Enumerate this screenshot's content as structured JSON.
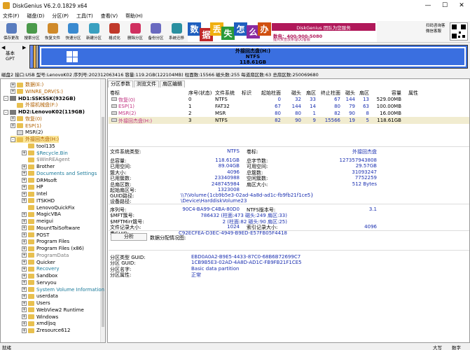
{
  "title": "DiskGenius V6.2.0.1829 x64",
  "menu": [
    "文件(F)",
    "磁盘(D)",
    "分区(P)",
    "工具(T)",
    "查看(V)",
    "帮助(H)"
  ],
  "toolbar": [
    {
      "label": "保存更改",
      "color": "#5a7dbf"
    },
    {
      "label": "搜索分区",
      "color": "#4b9a4b"
    },
    {
      "label": "恢复文件",
      "color": "#d08a2a"
    },
    {
      "label": "快速分区",
      "color": "#3a8ad0"
    },
    {
      "label": "新建分区",
      "color": "#3aa0c0"
    },
    {
      "label": "格式化",
      "color": "#c0392b"
    },
    {
      "label": "删除分区",
      "color": "#d03060"
    },
    {
      "label": "备份分区",
      "color": "#6a6ac0"
    },
    {
      "label": "系统迁移",
      "color": "#2a90a0"
    }
  ],
  "banner": {
    "tiles": [
      {
        "char": "数",
        "color": "#1f5fbf"
      },
      {
        "char": "据",
        "color": "#c0282a"
      },
      {
        "char": "丢",
        "color": "#f0b010"
      },
      {
        "char": "失",
        "color": "#2a9a3a"
      },
      {
        "char": "怎",
        "color": "#1f5fbf"
      },
      {
        "char": "么",
        "color": "#8a2aa0"
      },
      {
        "char": "办",
        "color": "#d05010"
      }
    ],
    "slogan": "DiskGenius 团队为您服务",
    "phone": "数电：400-900-5080",
    "sub": "提点资查放条理QQ客服"
  },
  "qr_label": [
    "扫码咨询客",
    "微信客服"
  ],
  "disk_map": {
    "basic": "基本",
    "gpt": "GPT",
    "label": "外接回杰盘(H:)",
    "fs": "NTFS",
    "size": "118.61GB"
  },
  "disk_info": "磁盘2 接口:USB  型号:LenovoK02  序列号:202312063416  容量:119.2GB(122104MB)  柱面数:15566  磁头数:255  每道扇区数:63  总扇区数:250069680",
  "tree": [
    {
      "indent": 14,
      "exp": "+",
      "icon": "fld",
      "text": "数据(E:)",
      "color": "#b06000"
    },
    {
      "indent": 14,
      "exp": "+",
      "icon": "fld",
      "text": "WINRE_DRV(S:)",
      "color": "#b06000"
    },
    {
      "indent": 4,
      "exp": "-",
      "icon": "dsk",
      "text": "HD1:SSKSSK(932GB)",
      "color": "#000",
      "bold": true
    },
    {
      "indent": 14,
      "exp": "",
      "icon": "fld",
      "text": "外接机械盘(F:)",
      "color": "#b06000"
    },
    {
      "indent": 4,
      "exp": "-",
      "icon": "dsk",
      "text": "HD2:LenovoK02(119GB)",
      "color": "#000",
      "bold": true
    },
    {
      "indent": 14,
      "exp": "+",
      "icon": "fld",
      "text": "恢复(0)",
      "color": "#b06000"
    },
    {
      "indent": 14,
      "exp": "+",
      "icon": "fld",
      "text": "ESP(1)",
      "color": "#b06000"
    },
    {
      "indent": 14,
      "exp": "",
      "icon": "prt",
      "text": "MSR(2)",
      "color": "#000"
    },
    {
      "indent": 14,
      "exp": "-",
      "icon": "fld",
      "text": "外接回杰盘(H:)",
      "color": "#b06000",
      "selected": true
    },
    {
      "indent": 30,
      "exp": "",
      "icon": "fld",
      "text": "tool135",
      "color": "#000"
    },
    {
      "indent": 30,
      "exp": "+",
      "icon": "fld",
      "text": "$Recycle.Bin",
      "color": "#1a7a9a"
    },
    {
      "indent": 30,
      "exp": "",
      "icon": "fld",
      "text": "$WinREAgent",
      "color": "#777"
    },
    {
      "indent": 30,
      "exp": "+",
      "icon": "fld",
      "text": "Brother",
      "color": "#000"
    },
    {
      "indent": 30,
      "exp": "+",
      "icon": "fld",
      "text": "Documents and Settings",
      "color": "#1a7a9a"
    },
    {
      "indent": 30,
      "exp": "+",
      "icon": "fld",
      "text": "DRMsoft",
      "color": "#000"
    },
    {
      "indent": 30,
      "exp": "+",
      "icon": "fld",
      "text": "HP",
      "color": "#000"
    },
    {
      "indent": 30,
      "exp": "+",
      "icon": "fld",
      "text": "Intel",
      "color": "#000"
    },
    {
      "indent": 30,
      "exp": "+",
      "icon": "fld",
      "text": "ITSKHD",
      "color": "#000"
    },
    {
      "indent": 30,
      "exp": "",
      "icon": "fld",
      "text": "LenovoQuickFix",
      "color": "#000"
    },
    {
      "indent": 30,
      "exp": "+",
      "icon": "fld",
      "text": "MagicVBA",
      "color": "#000"
    },
    {
      "indent": 30,
      "exp": "+",
      "icon": "fld",
      "text": "meigui",
      "color": "#000"
    },
    {
      "indent": 30,
      "exp": "+",
      "icon": "fld",
      "text": "MountTaiSoftware",
      "color": "#000"
    },
    {
      "indent": 30,
      "exp": "+",
      "icon": "fld",
      "text": "POST",
      "color": "#000"
    },
    {
      "indent": 30,
      "exp": "+",
      "icon": "fld",
      "text": "Program Files",
      "color": "#000"
    },
    {
      "indent": 30,
      "exp": "+",
      "icon": "fld",
      "text": "Program Files (x86)",
      "color": "#000"
    },
    {
      "indent": 30,
      "exp": "+",
      "icon": "fld",
      "text": "ProgramData",
      "color": "#777"
    },
    {
      "indent": 30,
      "exp": "+",
      "icon": "fld",
      "text": "Quicker",
      "color": "#000"
    },
    {
      "indent": 30,
      "exp": "+",
      "icon": "fld",
      "text": "Recovery",
      "color": "#1a7a9a"
    },
    {
      "indent": 30,
      "exp": "+",
      "icon": "fld",
      "text": "Sandbox",
      "color": "#000"
    },
    {
      "indent": 30,
      "exp": "+",
      "icon": "fld",
      "text": "Servyou",
      "color": "#000"
    },
    {
      "indent": 30,
      "exp": "+",
      "icon": "fld",
      "text": "System Volume Information",
      "color": "#1a7a9a"
    },
    {
      "indent": 30,
      "exp": "+",
      "icon": "fld",
      "text": "userdata",
      "color": "#000"
    },
    {
      "indent": 30,
      "exp": "+",
      "icon": "fld",
      "text": "Users",
      "color": "#000"
    },
    {
      "indent": 30,
      "exp": "+",
      "icon": "fld",
      "text": "WebView2 Runtime",
      "color": "#000"
    },
    {
      "indent": 30,
      "exp": "+",
      "icon": "fld",
      "text": "Windows",
      "color": "#000"
    },
    {
      "indent": 30,
      "exp": "+",
      "icon": "fld",
      "text": "xmdljsq",
      "color": "#000"
    },
    {
      "indent": 30,
      "exp": "+",
      "icon": "fld",
      "text": "Zresource612",
      "color": "#000"
    }
  ],
  "tabs": [
    "分区参数",
    "浏览文件",
    "扇区编辑"
  ],
  "partition_table": {
    "headers": [
      "卷标",
      "序号(状态)",
      "文件系统",
      "标识",
      "起始柱面",
      "磁头",
      "扇区",
      "终止柱面",
      "磁头",
      "扇区",
      "容量",
      "属性"
    ],
    "rows": [
      [
        "恢复(0)",
        "0",
        "NTFS",
        "",
        "0",
        "32",
        "33",
        "67",
        "144",
        "13",
        "529.00MB",
        ""
      ],
      [
        "ESP(1)",
        "1",
        "FAT32",
        "",
        "67",
        "144",
        "14",
        "80",
        "79",
        "63",
        "100.00MB",
        ""
      ],
      [
        "MSR(2)",
        "2",
        "MSR",
        "",
        "80",
        "80",
        "1",
        "82",
        "90",
        "8",
        "16.00MB",
        ""
      ],
      [
        "外接回杰盘(H:)",
        "3",
        "NTFS",
        "",
        "82",
        "90",
        "9",
        "15566",
        "19",
        "5",
        "118.61GB",
        ""
      ]
    ]
  },
  "fs_info": {
    "fs_type_label": "文件系统类型:",
    "fs_type": "NTFS",
    "volume_label": "卷标:",
    "volume": "外接回杰盘",
    "rows": [
      [
        "总容量:",
        "118.61GB",
        "总字节数:",
        "127357943808"
      ],
      [
        "已用空间:",
        "89.04GB",
        "可用空间:",
        "29.57GB"
      ],
      [
        "簇大小:",
        "4096",
        "总簇数:",
        "31093247"
      ],
      [
        "已用簇数:",
        "23340988",
        "空闲簇数:",
        "7752259"
      ],
      [
        "总扇区数:",
        "248745984",
        "扇区大小:",
        "512 Bytes"
      ],
      [
        "起始扇区号:",
        "1323008",
        "",
        ""
      ]
    ],
    "guid_path_label": "GUID路径:",
    "guid_path": "\\\\?\\Volume{1cb9b5e3-02ad-4a8d-ad1c-fb9fb21f1ce5}",
    "device_path_label": "设备路径:",
    "device_path": "\\Device\\HarddiskVolume23",
    "rows2": [
      [
        "序列号:",
        "90C4-BA99-C4BA-80D0",
        "NTFS版本号:",
        "3.1"
      ],
      [
        "$MFT簇号:",
        "786432 (柱面:473 磁头:249 扇区:33)",
        "",
        ""
      ],
      [
        "$MFTMirr簇号:",
        "2 (柱面:82 磁头:90 扇区:25)",
        "",
        ""
      ],
      [
        "文件记录大小:",
        "1024",
        "索引记录大小:",
        "4096"
      ],
      [
        "卷GUID:",
        "C92ECFEA-D3EC-4949-B9ED-E57FB05F4418",
        "",
        ""
      ]
    ],
    "analyze_button": "分析",
    "alloc_label": "数据分配情况图:",
    "rows3": [
      [
        "分区类型 GUID:",
        "EBD0A0A2-B9E5-4433-87C0-68B6B72699C7"
      ],
      [
        "分区 GUID:",
        "1CB9B5E3-02AD-4A8D-AD1C-FB9FB21F1CE5"
      ],
      [
        "分区名字:",
        "Basic data partition"
      ],
      [
        "分区属性:",
        "正常"
      ]
    ]
  },
  "status": {
    "left": "就绪",
    "caps": "大写",
    "num": "数字"
  }
}
